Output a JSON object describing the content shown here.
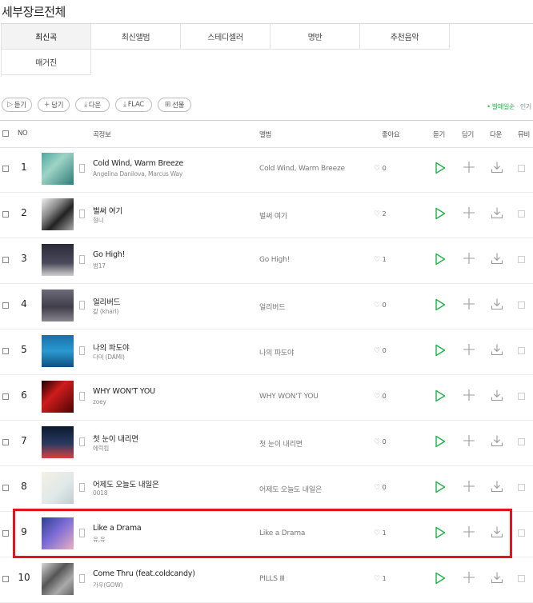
{
  "page": {
    "title": "세부장르전체"
  },
  "tabs": [
    {
      "label": "최신곡",
      "active": true
    },
    {
      "label": "최신앨범",
      "active": false
    },
    {
      "label": "스테디셀러",
      "active": false
    },
    {
      "label": "명반",
      "active": false
    },
    {
      "label": "추천음악",
      "active": false
    },
    {
      "label": "매거진",
      "active": false
    }
  ],
  "toolbar": {
    "listen": "듣기",
    "add": "담기",
    "download": "다운",
    "flac": "FLAC",
    "gift": "선물"
  },
  "sort": {
    "popular_sales": "발매일순",
    "popular": "인기"
  },
  "header": {
    "no": "NO",
    "song_info": "곡정보",
    "album": "앨범",
    "like": "좋아요",
    "listen": "듣기",
    "add": "담기",
    "download": "다운",
    "mv": "뮤비"
  },
  "rows": [
    {
      "rank": "1",
      "title": "Cold Wind, Warm Breeze",
      "artist": "Angelina Danilova, Marcus Way",
      "album": "Cold Wind, Warm Breeze",
      "likes": "0"
    },
    {
      "rank": "2",
      "title": "벌써 여기",
      "artist": "형니",
      "album": "벌써 여기",
      "likes": "2"
    },
    {
      "rank": "3",
      "title": "Go High!",
      "artist": "범17",
      "album": "Go High!",
      "likes": "1"
    },
    {
      "rank": "4",
      "title": "얼리버드",
      "artist": "칼 (kharl)",
      "album": "얼리버드",
      "likes": "0"
    },
    {
      "rank": "5",
      "title": "나의 파도야",
      "artist": "다미 (DAMI)",
      "album": "나의 파도야",
      "likes": "0"
    },
    {
      "rank": "6",
      "title": "WHY WON'T YOU",
      "artist": "zoey",
      "album": "WHY WON'T YOU",
      "likes": "0"
    },
    {
      "rank": "7",
      "title": "첫 눈이 내리면",
      "artist": "에릭킴",
      "album": "첫 눈이 내리면",
      "likes": "0"
    },
    {
      "rank": "8",
      "title": "어제도 오늘도 내일은",
      "artist": "0018",
      "album": "어제도 오늘도 내일은",
      "likes": "0"
    },
    {
      "rank": "9",
      "title": "Like a Drama",
      "artist": "유,유",
      "album": "Like a Drama",
      "likes": "1"
    },
    {
      "rank": "10",
      "title": "Come Thru (feat.coldcandy)",
      "artist": "가우(GOW)",
      "album": "PILLS Ⅲ",
      "likes": "1"
    }
  ],
  "colors": {
    "accent_green": "#1fb44a",
    "highlight_red": "#e3141f"
  }
}
